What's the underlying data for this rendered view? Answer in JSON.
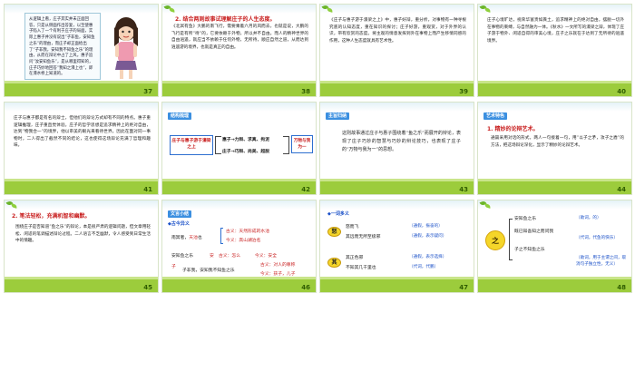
{
  "slides": [
    {
      "page": "37",
      "bubble_text": "从逻辑上看，庄子其实并未正面回答，只是从侧面作出答复，以至使惠子陷入了一个有利于庄子的局面，实际上惠子并没有说出“子非鱼，安知鱼之乐”的理由，而庄子却正面给出了“子非我，安知我不知鱼之乐”的理由，从而在辩论中占了上风。惠子追问“汝安知鱼乐”，是从哪里得知的，庄子巧妙地回答“我知之濠上也”，即在濠水桥上知道的。"
    },
    {
      "page": "38",
      "heading": "2. 结合两则故事试理解庄子的人生态度。",
      "body": "《北冥有鱼》大鹏的南飞行，需要乘着六月的风而去，也就是说，大鹏的飞行是有所“待”的，它要依赖于外物，所以并不自由。而人的精神世界的自由逍遥，就应当不依赖于任何外物，无所待，顺应自然之道，从而达到逍遥游的境界，也就是真正的自由。"
    },
    {
      "page": "39",
      "body": "《庄子与惠子游于濠梁之上》中，惠子好辩，重分析，对事物有一种寻根究底的认知态度，重在知识的探讨；庄子好游，重观赏，对于外界的认识，带有欣赏的态度。将主观的情意发挥到外在事物上而产生移情同感的作用，这种人生态度就具有艺术性。"
    },
    {
      "page": "40",
      "body": "庄子心境旷达，视荣华富贵如粪土，追求精神上的绝对自由，摆脱一切外在事物的束缚，与自然融为一体。《秋水》一文所写的濠梁之辩，体现了庄子游于物外、闲适自得的审美心境，庄子之乐就在于达到了无所待的逍遥境界。"
    },
    {
      "page": "41",
      "body": "庄子与惠子都是有名的辩士，但他们的辩论方式却有不同的特点。惠子重逻辑推理，庄子重直觉体验。庄子的哲学思想是追求精神上的绝对自由，达到“物我合一”的境界，他以审美的眼光来看待世界。因此在面对同一事物时，二人得出了截然不同的结论，这也使得这场辩论充满了哲理和趣味。"
    },
    {
      "page": "42",
      "tag": "结构梳理",
      "left_box": "庄子与惠子游于濠梁之上",
      "row1": "惠子→力辩、求真、拘泥",
      "row2": "庄子→巧辩、尚美、超脱",
      "right_box": "万物与我为一"
    },
    {
      "page": "43",
      "tag": "主旨归纳",
      "body": "这则故事通过庄子与惠子围绕着“鱼之乐”而展开的辩论，表现了庄子巧妙的智慧与巧妙的辩论技巧，也表现了庄子的“万物与我为一”的思想。"
    },
    {
      "page": "44",
      "tag": "艺术特色",
      "heading": "1. 精妙的论辩艺术。",
      "body": "通篇采用对话的形式，两人一句接着一句，用“以子之矛，攻子之盾”的方法，把这场辩论深化，显示了精妙的论辩艺术。"
    },
    {
      "page": "45",
      "heading": "2. 笔法轻松，充满机智和幽默。",
      "body": "围绕庄子是否知道“鱼之乐”的辩论，本是很严肃的逻辑问题，但文章用轻松、闲适的笔调描述辩论过程。二人语言不乏幽默，令人感受到日常生活中的情趣。"
    },
    {
      "page": "46",
      "tag": "文言小结",
      "subheading": "◆古今异义",
      "line1_left": "南冥者，",
      "line1_red": "天池",
      "line1_right": "也",
      "line1_ancient": "古义：天然形成的水池",
      "line1_modern": "今义：高山湖泊名",
      "line2_left": "安知鱼之乐",
      "line2_red": "安",
      "line2_ancient": "古义：怎么",
      "line2_modern": "今义：安全",
      "line3_left": "子非我，安知我不知鱼之乐",
      "line3_red": "子",
      "line3_ancient": "古义：对人的尊称",
      "line3_modern": "今义：孩子，儿子"
    },
    {
      "page": "47",
      "subheading": "◆一词多义",
      "oval1": "怒",
      "oval1_line1": "怒而飞",
      "oval1_line1_gloss": "（通假，振奋的）",
      "oval1_line2": "其远而无所至极邪",
      "oval1_line2_gloss": "（通假，表示疑问）",
      "oval2": "其",
      "oval2_line1": "其正色邪",
      "oval2_line1_gloss": "（通假，表示选择）",
      "oval2_line2": "不知其几千里也",
      "oval2_line2_gloss": "（代词，代鹏）"
    },
    {
      "page": "48",
      "circle": "之",
      "line1": "安知鱼之乐",
      "line1_gloss": "（助词，的）",
      "line2": "既已知吾知之而问我",
      "line2_gloss": "（代词，代鱼的快乐）",
      "line3": "子之不知鱼之乐",
      "line3_gloss": "（助词，用于主谓之间，取消句子独立性，无义）"
    }
  ]
}
